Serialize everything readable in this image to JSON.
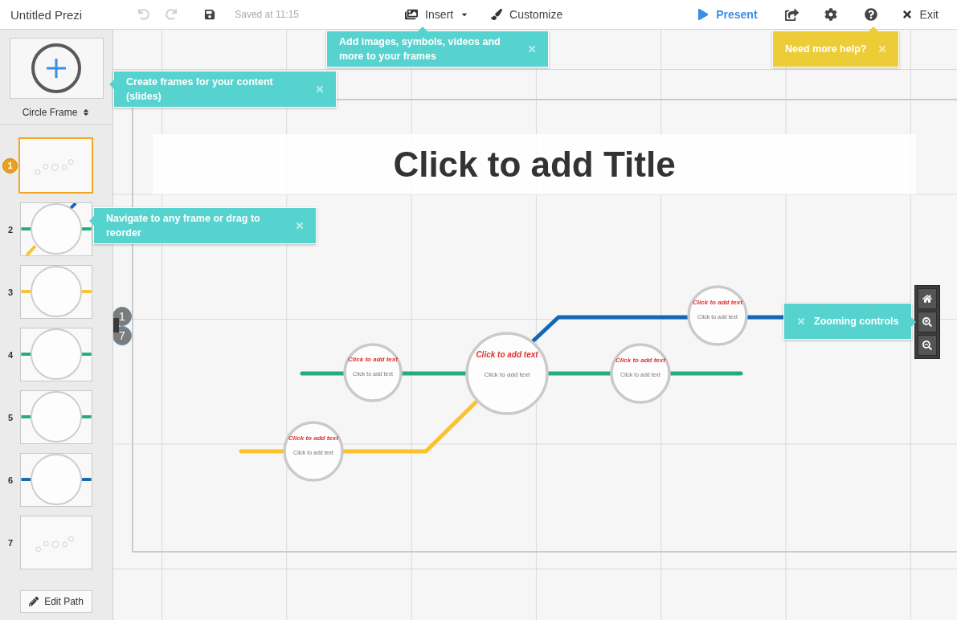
{
  "toolbar": {
    "title": "Untitled Prezi",
    "history": [
      {
        "kind": "undo",
        "disabled": true
      },
      {
        "kind": "redo",
        "disabled": true
      }
    ],
    "save_status": "Saved at 11:15",
    "insert": "Insert",
    "customize": "Customize",
    "present": "Present",
    "exit": "Exit"
  },
  "sidebar": {
    "frame_type": "Circle Frame",
    "frames": [
      {
        "number": "1",
        "selected": true,
        "kind": "overview"
      },
      {
        "number": "2",
        "selected": false,
        "kind": "junction",
        "color": "#22ad7a"
      },
      {
        "number": "3",
        "selected": false,
        "kind": "circle",
        "color": "#fbc22e"
      },
      {
        "number": "4",
        "selected": false,
        "kind": "circle",
        "color": "#22ad7a"
      },
      {
        "number": "5",
        "selected": false,
        "kind": "circle",
        "color": "#22ad7a"
      },
      {
        "number": "6",
        "selected": false,
        "kind": "circle",
        "color": "#1467b5"
      },
      {
        "number": "7",
        "selected": false,
        "kind": "overview"
      }
    ],
    "edit_path": "Edit Path"
  },
  "canvas": {
    "title_placeholder": "Click to add Title",
    "path_start": "1",
    "path_end": "7",
    "circles": [
      {
        "title": "Click to add text",
        "body": "Click to add text"
      },
      {
        "title": "Click to add text",
        "body": "Click to add text"
      },
      {
        "title": "Click to add text",
        "body": "Click to add text"
      },
      {
        "title": "Click to add text",
        "body": "Click to add text"
      },
      {
        "title": "Click to add text",
        "body": "Click to add text"
      }
    ]
  },
  "tips": [
    {
      "kind": "insert",
      "text": "Add images, symbols, videos and more to your frames"
    },
    {
      "kind": "help",
      "text": "Need more help?"
    },
    {
      "kind": "frames",
      "text": "Create frames for your content (slides)"
    },
    {
      "kind": "navigate",
      "text": "Navigate to any frame or drag to reorder"
    },
    {
      "kind": "zoom",
      "text": "Zooming controls"
    }
  ]
}
